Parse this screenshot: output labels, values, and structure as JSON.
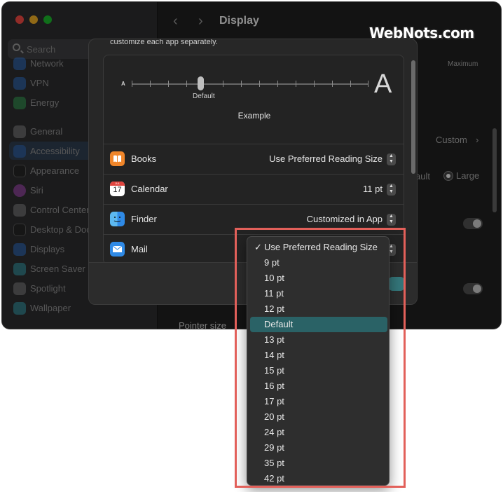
{
  "window": {
    "title": "Display"
  },
  "sidebar": {
    "search_placeholder": "Search",
    "items": [
      {
        "label": "Network",
        "icon": "network-icon",
        "color": "#2d7be0"
      },
      {
        "label": "VPN",
        "icon": "vpn-icon",
        "color": "#2d7be0"
      },
      {
        "label": "Energy",
        "icon": "energy-icon",
        "color": "#35b35a"
      },
      {
        "label": "General",
        "icon": "gear-icon",
        "color": "#8e8e93"
      },
      {
        "label": "Accessibility",
        "icon": "accessibility-icon",
        "color": "#2d7be0"
      },
      {
        "label": "Appearance",
        "icon": "appearance-icon",
        "color": "#1c1c1c"
      },
      {
        "label": "Siri",
        "icon": "siri-icon",
        "color": "#c44fd6"
      },
      {
        "label": "Control Center",
        "icon": "control-center-icon",
        "color": "#8e8e93"
      },
      {
        "label": "Desktop & Dock",
        "icon": "desktop-dock-icon",
        "color": "#1c1c1c"
      },
      {
        "label": "Displays",
        "icon": "displays-icon",
        "color": "#2d7be0"
      },
      {
        "label": "Screen Saver",
        "icon": "screen-saver-icon",
        "color": "#38b3c4"
      },
      {
        "label": "Spotlight",
        "icon": "spotlight-icon",
        "color": "#8e8e93"
      },
      {
        "label": "Wallpaper",
        "icon": "wallpaper-icon",
        "color": "#38b3c4"
      }
    ]
  },
  "background": {
    "maximum_label": "Maximum",
    "custom_label": "Custom",
    "fault_label": "ault",
    "large_label": "Large",
    "pointer_size_label": "Pointer size"
  },
  "sheet": {
    "intro_text": "customize each app separately.",
    "slider": {
      "small_glyph": "A",
      "large_glyph": "A",
      "knob_label": "Default"
    },
    "example_label": "Example",
    "apps": [
      {
        "name": "Books",
        "value": "Use Preferred Reading Size",
        "icon": "books-icon",
        "color": "#f0862a"
      },
      {
        "name": "Calendar",
        "value": "11 pt",
        "icon": "calendar-icon",
        "color": "#ffffff"
      },
      {
        "name": "Finder",
        "value": "Customized in App",
        "icon": "finder-icon",
        "color": "#2f8ae6"
      },
      {
        "name": "Mail",
        "value": "",
        "icon": "mail-icon",
        "color": "#2f8ae6"
      }
    ],
    "calendar_month": "JUL",
    "calendar_day": "17"
  },
  "menu": {
    "checkmark": "✓",
    "items": [
      "Use Preferred Reading Size",
      "9 pt",
      "10 pt",
      "11 pt",
      "12 pt",
      "Default",
      "13 pt",
      "14 pt",
      "15 pt",
      "16 pt",
      "17 pt",
      "20 pt",
      "24 pt",
      "29 pt",
      "35 pt",
      "42 pt"
    ],
    "checked_index": 0,
    "selected_index": 5,
    "selected_color": "#2a6266"
  },
  "watermark": "WebNots.com"
}
